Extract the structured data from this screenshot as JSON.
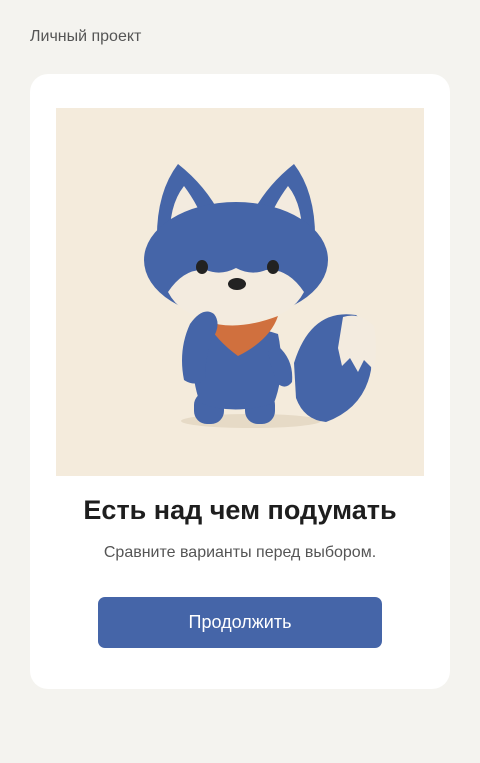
{
  "header": {
    "project_label": "Личный проект"
  },
  "card": {
    "illustration_icon": "fox-mascot-icon",
    "title": "Есть над чем подумать",
    "subtitle": "Сравните варианты перед выбором.",
    "continue_label": "Продолжить"
  },
  "colors": {
    "page_background": "#f4f3ef",
    "card_background": "#ffffff",
    "illustration_background": "#f4ebdc",
    "fox_blue": "#4565a8",
    "scarf_orange": "#d0703e",
    "button_background": "#4565a8",
    "button_text": "#ffffff"
  }
}
